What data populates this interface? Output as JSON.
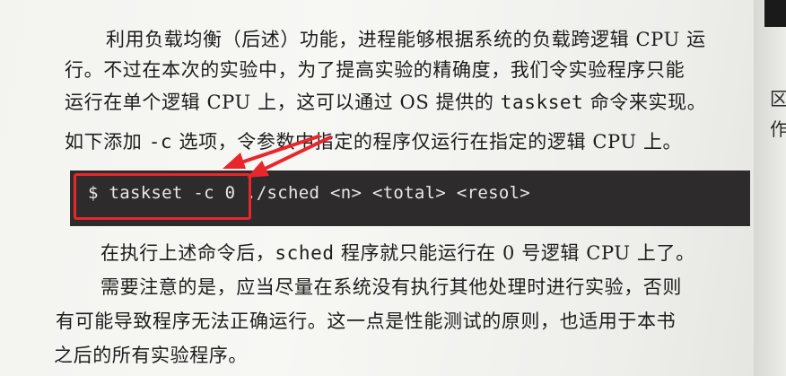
{
  "paragraph1": {
    "line1": "利用负载均衡（后述）功能，进程能够根据系统的负载跨逻辑 CPU 运",
    "line2": "行。不过在本次的实验中，为了提高实验的精确度，我们令实验程序只能",
    "line3_a": "运行在单个逻辑 CPU 上，这可以通过 OS 提供的 ",
    "line3_cmd": "taskset",
    "line3_b": " 命令来实现。",
    "line4_a": "如下添加 ",
    "line4_opt": "-c",
    "line4_b": " 选项，令参数中指定的程序仅运行在指定的逻辑 CPU 上。"
  },
  "code": {
    "command": "$ taskset -c 0 ./sched <n> <total> <resol>"
  },
  "paragraph2": {
    "line1_a": "在执行上述命令后，",
    "line1_cmd": "sched",
    "line1_b": " 程序就只能运行在 0 号逻辑 CPU 上了。"
  },
  "paragraph3": {
    "line1": "需要注意的是，应当尽量在系统没有执行其他处理时进行实验，否则",
    "line2": "有可能导致程序无法正确运行。这一点是性能测试的原则，也适用于本书",
    "line3": "之后的所有实验程序。"
  },
  "right_page": {
    "char1": "区",
    "char2": "作"
  },
  "annotation": {
    "color": "#e8262c"
  }
}
